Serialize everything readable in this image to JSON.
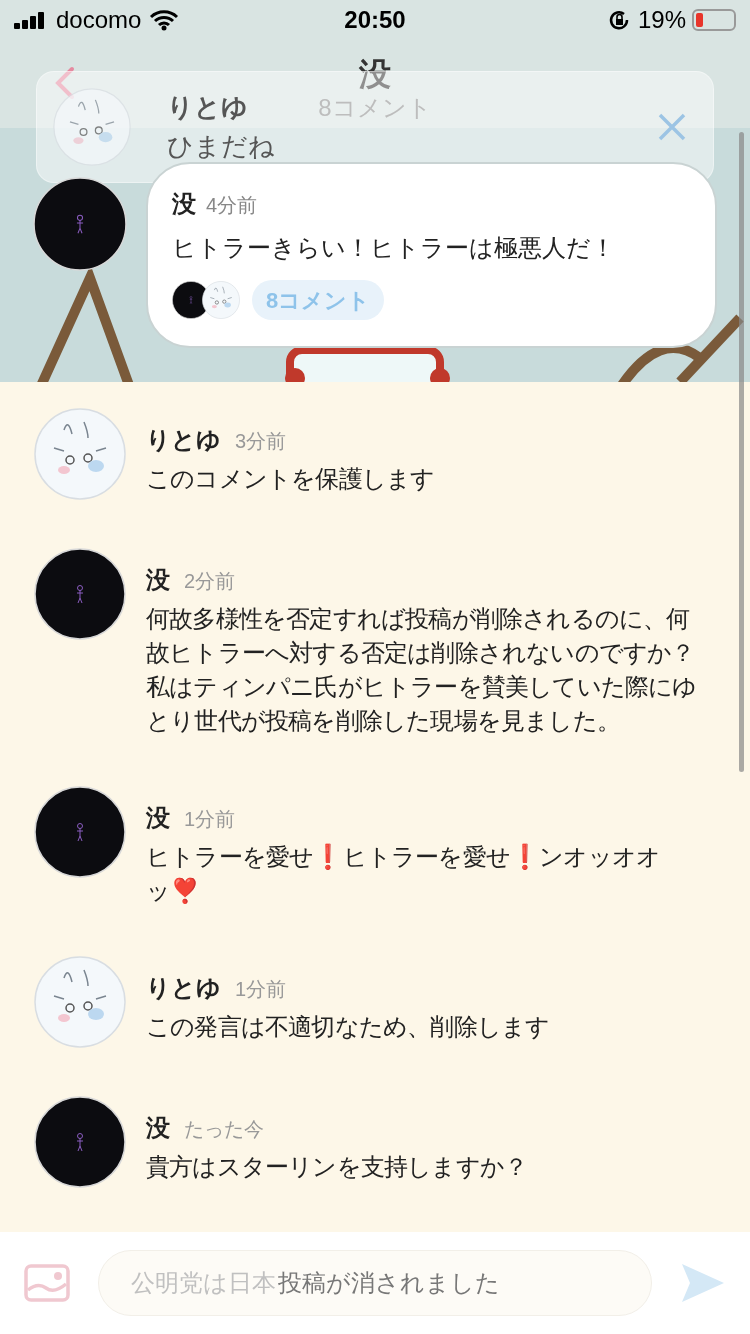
{
  "status_bar": {
    "carrier": "docomo",
    "time": "20:50",
    "battery": "19%"
  },
  "header": {
    "title": "没",
    "subtitle": "8コメント"
  },
  "notification": {
    "author": "りとゆ",
    "kind": "rabbit",
    "text": "ひまだね"
  },
  "post": {
    "author": "没",
    "time": "4分前",
    "kind": "dark",
    "text": "ヒトラーきらい！ヒトラーは極悪人だ！",
    "commenters": [
      {
        "kind": "dark"
      },
      {
        "kind": "rabbit"
      }
    ],
    "comment_count": "8コメント"
  },
  "comments": [
    {
      "author": "りとゆ",
      "time": "3分前",
      "kind": "rabbit",
      "text": "このコメントを保護します"
    },
    {
      "author": "没",
      "time": "2分前",
      "kind": "dark",
      "text": "何故多様性を否定すれば投稿が削除されるのに、何故ヒトラーへ対する否定は削除されないのですか？私はティンパニ氏がヒトラーを賛美していた際にゆとり世代が投稿を削除した現場を見ました。"
    },
    {
      "author": "没",
      "time": "1分前",
      "kind": "dark",
      "text": "ヒトラーを愛せ❗️ヒトラーを愛せ❗️ンオッオオッ❣️"
    },
    {
      "author": "りとゆ",
      "time": "1分前",
      "kind": "rabbit",
      "text": "この発言は不適切なため、削除します"
    },
    {
      "author": "没",
      "time": "たった今",
      "kind": "dark",
      "text": "貴方はスターリンを支持しますか？"
    }
  ],
  "composer": {
    "value": "公明党は日本",
    "toast": "投稿が消されました"
  }
}
